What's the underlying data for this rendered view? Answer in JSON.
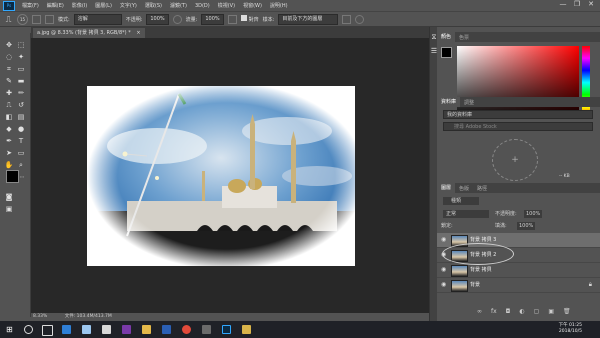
{
  "menu": {
    "items": [
      "檔案(F)",
      "編輯(E)",
      "影像(I)",
      "圖層(L)",
      "文字(Y)",
      "選取(S)",
      "濾鏡(T)",
      "3D(D)",
      "檢視(V)",
      "視窗(W)",
      "說明(H)"
    ],
    "window_controls": [
      "—",
      "❐",
      "✕"
    ]
  },
  "options": {
    "brush_size": "15",
    "mode_label": "模式:",
    "mode_value": "溶解",
    "opacity_label": "不透明:",
    "opacity_value": "100%",
    "flow_label": "流量:",
    "flow_value": "100%",
    "aligned_label": "對齊",
    "sample_label": "樣本:",
    "sample_value": "目前及下方的圖層"
  },
  "document": {
    "tab_title": "a.jpg @ 8.33% (背景 拷貝 3, RGB/8*) *",
    "close": "×"
  },
  "status": {
    "zoom": "8.33%",
    "doc_info": "文件: 103.4M/413.7M"
  },
  "panels": {
    "color_tabs": [
      "顏色",
      "色票"
    ],
    "library_tabs": [
      "資料庫",
      "調整"
    ],
    "library_select": "我的資料庫",
    "library_search": "搜尋 Adobe Stock",
    "library_size": "-- KB",
    "layers_tabs": [
      "圖層",
      "色版",
      "路徑"
    ],
    "layer_filter": "種類",
    "blend_mode": "正常",
    "opacity_label": "不透明度:",
    "opacity_value": "100%",
    "lock_label": "鎖定:",
    "fill_label": "填滿:",
    "fill_value": "100%"
  },
  "layers": [
    {
      "name": "背景 拷貝 3",
      "selected": true,
      "locked": false
    },
    {
      "name": "背景 拷貝 2",
      "selected": false,
      "locked": false
    },
    {
      "name": "背景 拷貝",
      "selected": false,
      "locked": false
    },
    {
      "name": "背景",
      "selected": false,
      "locked": true
    }
  ],
  "taskbar": {
    "time": "下午 01:25",
    "date": "2018/10/5",
    "icons": [
      "start-icon",
      "search-icon",
      "task-view-icon",
      "edge-icon",
      "onedrive-icon",
      "store-icon",
      "onenote-icon",
      "file-explorer-icon",
      "word-icon",
      "chrome-icon",
      "video-icon",
      "photoshop-icon",
      "folder-icon"
    ]
  },
  "colors": {
    "accent": "#31a8ff",
    "ui_bg": "#535353",
    "canvas_bg": "#282828",
    "taskbar": "#1f2127"
  }
}
